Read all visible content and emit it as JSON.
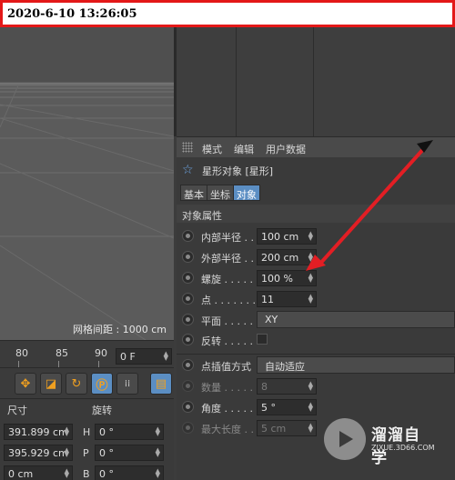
{
  "timestamp": "2020-6-10 13:26:05",
  "viewport": {
    "grid_spacing_label": "网格间距 : 1000 cm"
  },
  "attributes": {
    "menu": [
      "模式",
      "编辑",
      "用户数据"
    ],
    "object_title": "星形对象 [星形]",
    "tabs": [
      "基本",
      "坐标",
      "对象"
    ],
    "active_tab": "对象",
    "section_title": "对象属性",
    "params": [
      {
        "label": "内部半径 . .",
        "value": "100 cm"
      },
      {
        "label": "外部半径 . .",
        "value": "200 cm"
      },
      {
        "label": "螺旋 . . . . . .",
        "value": "100 %"
      },
      {
        "label": "点 . . . . . . . .",
        "value": "11"
      },
      {
        "label": "平面 . . . . . .",
        "value": "XY"
      },
      {
        "label": "反转 . . . . . .",
        "value": ""
      }
    ],
    "interp": [
      {
        "label": "点插值方式",
        "value": "自动适应"
      },
      {
        "label": "数量 . . . . . .",
        "value": "8"
      },
      {
        "label": "角度 . . . . . .",
        "value": "5 °"
      },
      {
        "label": "最大长度 . .",
        "value": "5 cm"
      }
    ]
  },
  "timeline": {
    "ticks": [
      "80",
      "85",
      "90"
    ],
    "frame": "0 F"
  },
  "coords": {
    "size_header": "尺寸",
    "rotation_header": "旋转",
    "size_values": [
      "391.899 cm",
      "395.929 cm",
      "0 cm"
    ],
    "rot_axes": [
      "H",
      "P",
      "B"
    ],
    "rot_values": [
      "0 °",
      "0 °",
      "0 °"
    ]
  },
  "watermark": {
    "title": "溜溜自学",
    "subtitle": "ZIXUE.3D66.COM"
  },
  "colors": {
    "arrow": "#e31e24",
    "accent": "#5b8ec3",
    "star": "#6fa8e8"
  },
  "icons": [
    "star-icon",
    "move-icon",
    "scale-icon",
    "rotate-icon",
    "record-icon",
    "keyframe-grid-icon",
    "film-icon",
    "play-watermark-icon"
  ]
}
